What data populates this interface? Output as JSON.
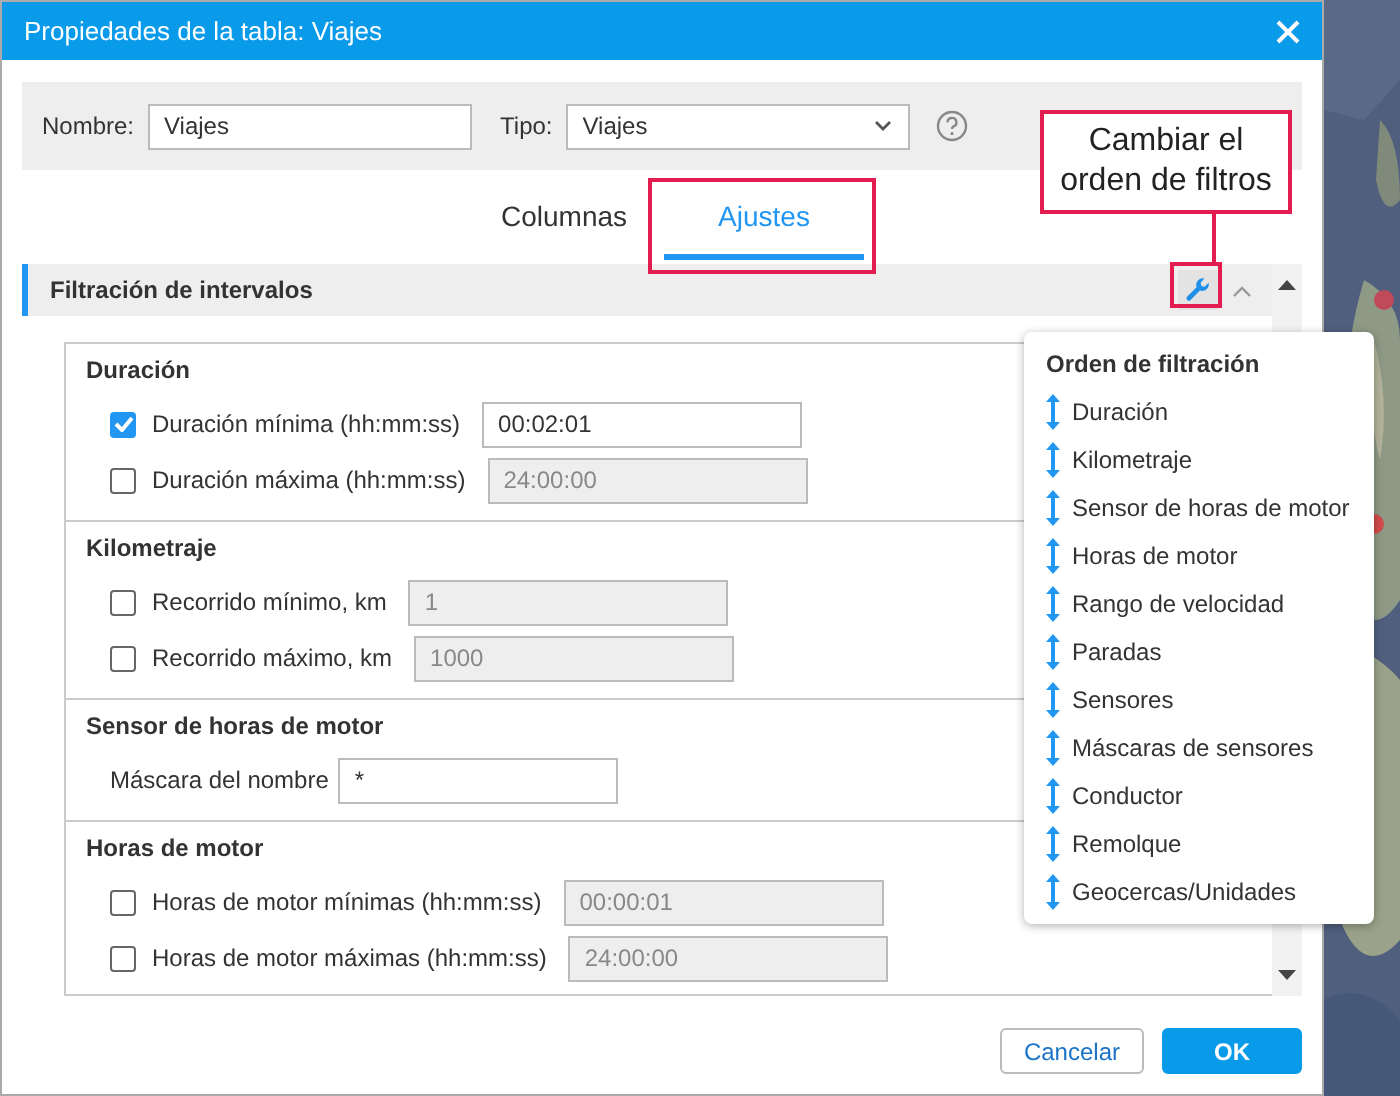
{
  "window": {
    "title": "Propiedades de la tabla: Viajes"
  },
  "form": {
    "name_label": "Nombre:",
    "name_value": "Viajes",
    "type_label": "Tipo:",
    "type_value": "Viajes"
  },
  "tabs": [
    {
      "label": "Columnas",
      "selected": false
    },
    {
      "label": "Ajustes",
      "selected": true
    }
  ],
  "section": {
    "title": "Filtración de intervalos",
    "expanded": true
  },
  "groups": [
    {
      "title": "Duración",
      "rows": [
        {
          "kind": "checkbox",
          "label": "Duración mínima (hh:mm:ss)",
          "checked": true,
          "value": "00:02:01"
        },
        {
          "kind": "checkbox",
          "label": "Duración máxima (hh:mm:ss)",
          "checked": false,
          "value": "24:00:00"
        }
      ]
    },
    {
      "title": "Kilometraje",
      "rows": [
        {
          "kind": "checkbox",
          "label": "Recorrido mínimo, km",
          "checked": false,
          "value": "1"
        },
        {
          "kind": "checkbox",
          "label": "Recorrido máximo, km",
          "checked": false,
          "value": "1000"
        }
      ]
    },
    {
      "title": "Sensor de horas de motor",
      "rows": [
        {
          "kind": "text",
          "label": "Máscara del nombre",
          "value": "*"
        }
      ]
    },
    {
      "title": "Horas de motor",
      "rows": [
        {
          "kind": "checkbox",
          "label": "Horas de motor mínimas (hh:mm:ss)",
          "checked": false,
          "value": "00:00:01"
        },
        {
          "kind": "checkbox",
          "label": "Horas de motor máximas (hh:mm:ss)",
          "checked": false,
          "value": "24:00:00"
        }
      ]
    }
  ],
  "filter_order_popup": {
    "title": "Orden de filtración",
    "items": [
      "Duración",
      "Kilometraje",
      "Sensor de horas de motor",
      "Horas de motor",
      "Rango de velocidad",
      "Paradas",
      "Sensores",
      "Máscaras de sensores",
      "Conductor",
      "Remolque",
      "Geocercas/Unidades"
    ]
  },
  "callout": {
    "text": "Cambiar el orden de filtros"
  },
  "buttons": [
    {
      "label": "Cancelar",
      "kind": "secondary"
    },
    {
      "label": "OK",
      "kind": "primary"
    }
  ]
}
